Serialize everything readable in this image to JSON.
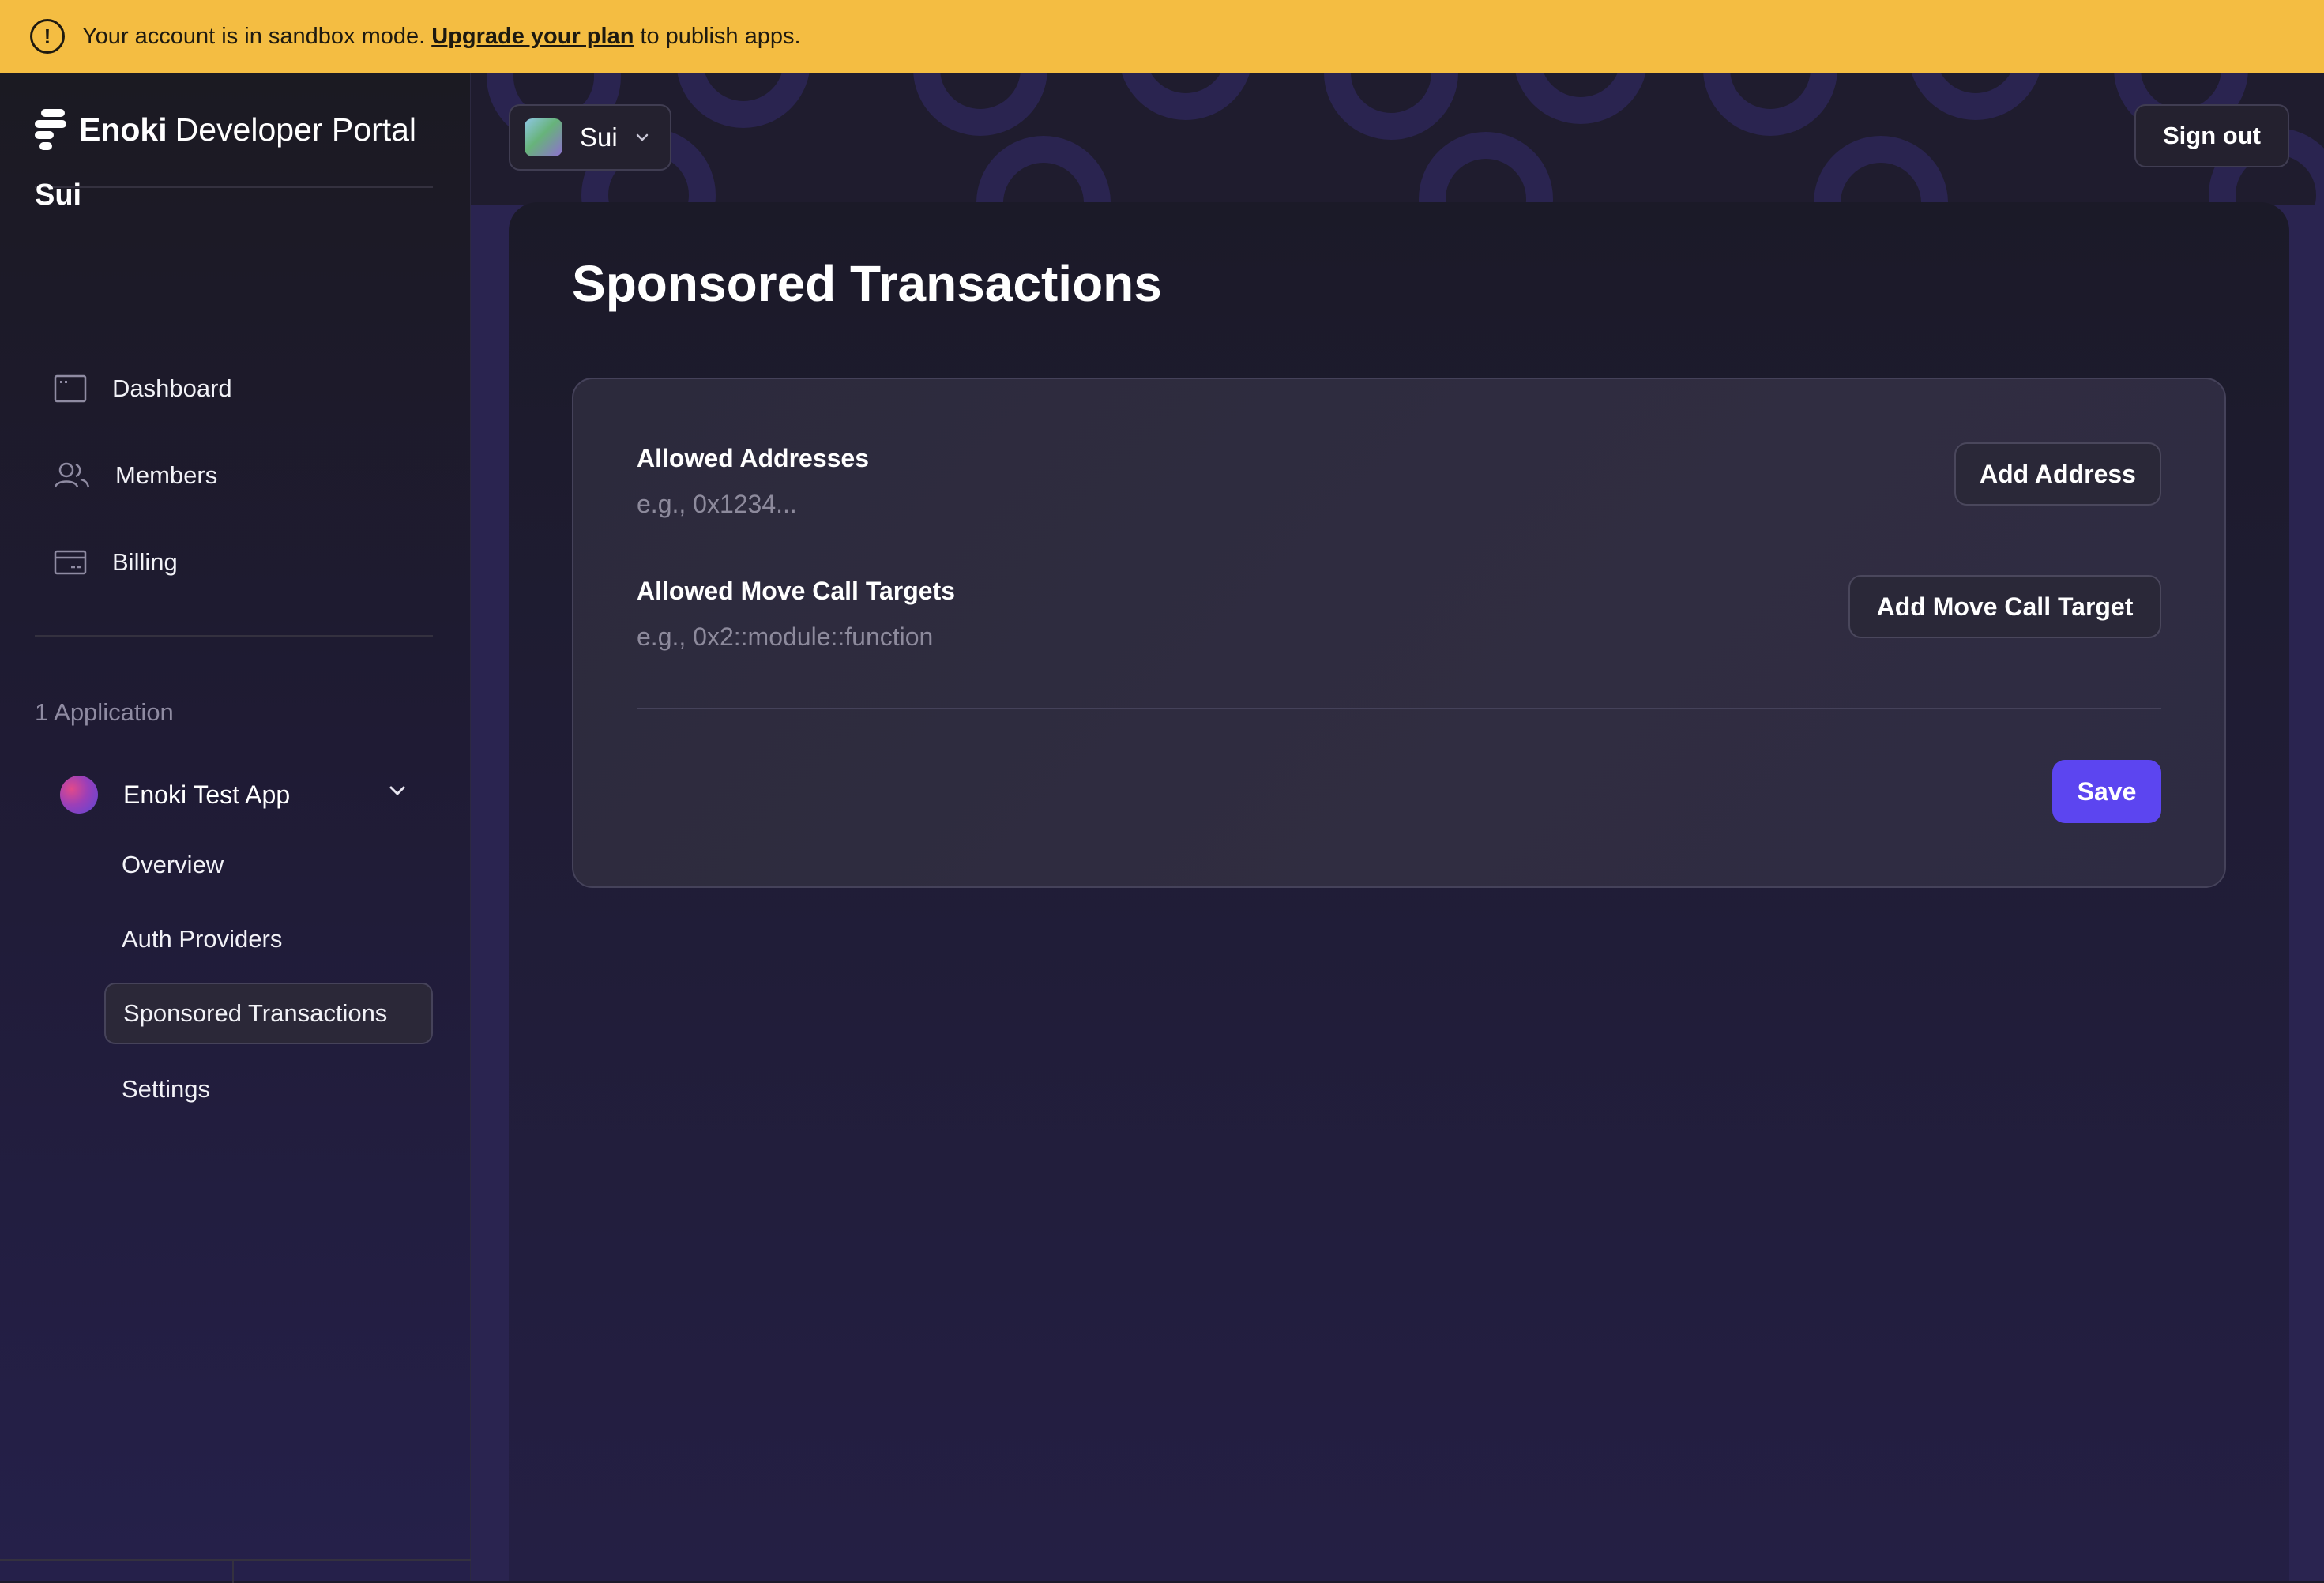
{
  "banner": {
    "message_prefix": "Your account is in sandbox mode.",
    "link_text": "Upgrade your plan",
    "message_suffix": "to publish apps.",
    "icon": "alert-circle-icon",
    "background_color": "#f4bd42"
  },
  "sidebar": {
    "logo_brand": "Enoki",
    "logo_product": "Developer Portal",
    "org_name": "Sui",
    "nav": [
      {
        "label": "Dashboard",
        "icon": "dashboard-icon"
      },
      {
        "label": "Members",
        "icon": "members-icon"
      },
      {
        "label": "Billing",
        "icon": "billing-icon"
      }
    ],
    "apps_section_label": "1 Application",
    "app": {
      "name": "Enoki Test App",
      "items": [
        {
          "label": "Overview",
          "active": false
        },
        {
          "label": "Auth Providers",
          "active": false
        },
        {
          "label": "Sponsored Transactions",
          "active": true
        },
        {
          "label": "Settings",
          "active": false
        }
      ]
    }
  },
  "header": {
    "network_selector": "Sui",
    "sign_out_label": "Sign out"
  },
  "main": {
    "title": "Sponsored Transactions",
    "fields": [
      {
        "label": "Allowed Addresses",
        "placeholder": "e.g., 0x1234...",
        "button_label": "Add Address"
      },
      {
        "label": "Allowed Move Call Targets",
        "placeholder": "e.g., 0x2::module::function",
        "button_label": "Add Move Call Target"
      }
    ],
    "save_label": "Save",
    "accent_color": "#5c45f0"
  }
}
